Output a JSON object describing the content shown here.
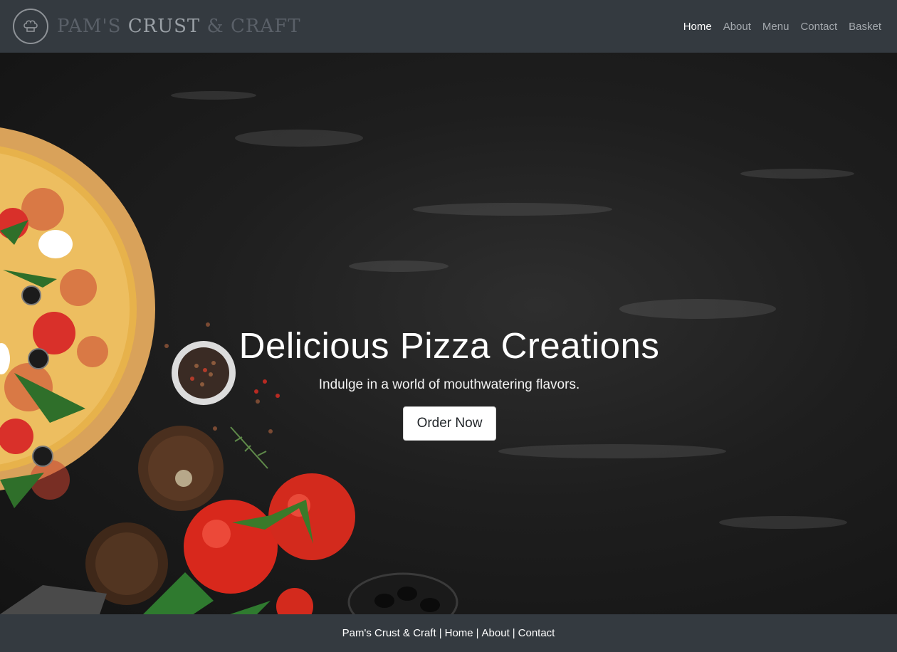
{
  "brand": {
    "name_part1": "PAM'S",
    "name_part2": "CRUST",
    "name_part3": "& CRAFT",
    "logo_icon": "chef-hat-icon"
  },
  "nav": {
    "items": [
      {
        "label": "Home",
        "active": true
      },
      {
        "label": "About",
        "active": false
      },
      {
        "label": "Menu",
        "active": false
      },
      {
        "label": "Contact",
        "active": false
      },
      {
        "label": "Basket",
        "active": false
      }
    ]
  },
  "hero": {
    "title": "Delicious Pizza Creations",
    "subtitle": "Indulge in a world of mouthwatering flavors.",
    "cta_label": "Order Now"
  },
  "footer": {
    "brand": "Pam's Crust & Craft",
    "links": [
      "Home",
      "About",
      "Contact"
    ],
    "separator": "|"
  },
  "colors": {
    "navbar_bg": "#343a40",
    "hero_bg": "#1e1e1e",
    "nav_active": "#ffffff",
    "nav_inactive": "#a4a9ae",
    "button_bg": "#ffffff"
  }
}
